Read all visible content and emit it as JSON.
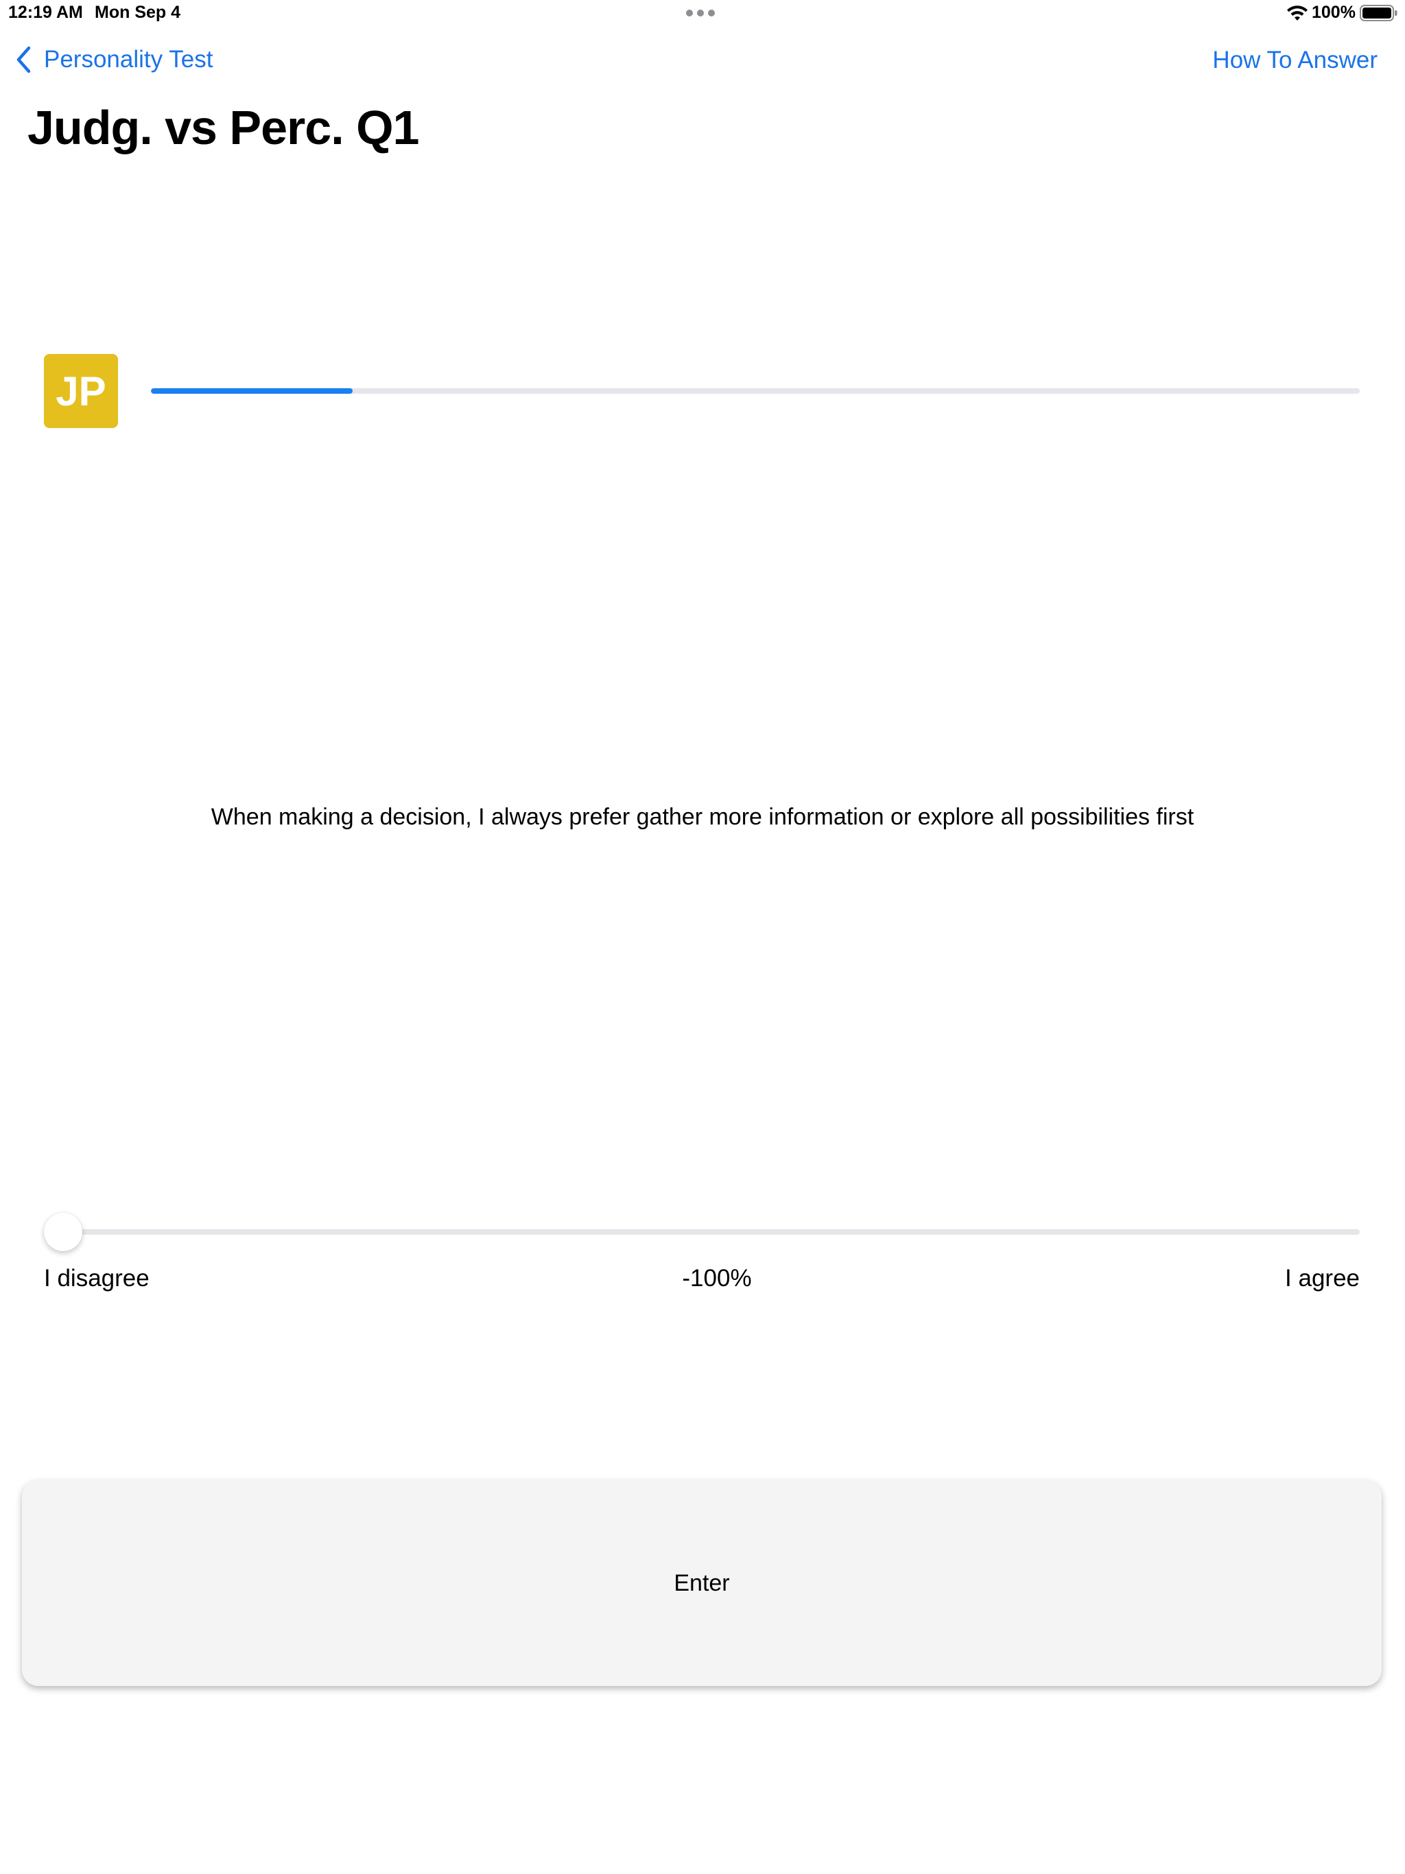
{
  "status_bar": {
    "time": "12:19 AM",
    "date": "Mon Sep 4",
    "battery": "100%",
    "icons": [
      "wifi-icon",
      "battery-icon",
      "multitask-dots-icon"
    ]
  },
  "nav": {
    "back_label": "Personality Test",
    "right_label": "How To Answer",
    "back_icon": "chevron-left-icon"
  },
  "page": {
    "title": "Judg. vs Perc. Q1"
  },
  "progress": {
    "badge": "JP",
    "fraction": 0.167
  },
  "question": {
    "text": "When making a decision, I always prefer gather more information or explore all possibilities first"
  },
  "slider": {
    "min_label": "I disagree",
    "max_label": "I agree",
    "value_label": "-100%",
    "value": -100,
    "min": -100,
    "max": 100
  },
  "actions": {
    "enter_label": "Enter"
  },
  "colors": {
    "accent": "#1a73e8",
    "progress_fill": "#1a7ff0",
    "badge": "#e4bf1e",
    "track": "#e5e5ea",
    "button_bg": "#f4f4f4"
  }
}
